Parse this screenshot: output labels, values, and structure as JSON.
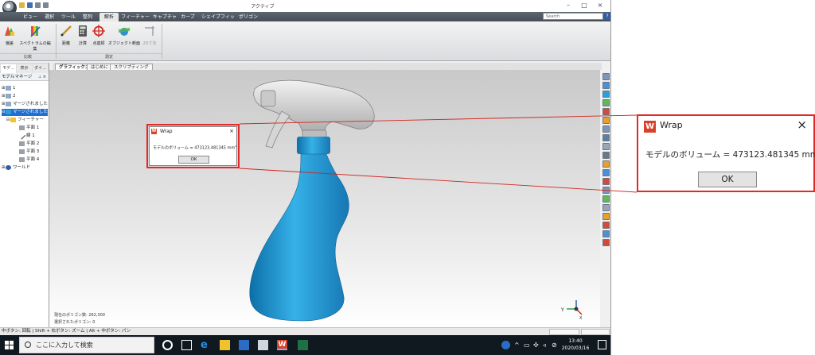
{
  "app": {
    "title": "アクティブ",
    "tabs": [
      {
        "label": "ビュー"
      },
      {
        "label": "選択"
      },
      {
        "label": "ツール"
      },
      {
        "label": "整列"
      },
      {
        "label": "解析"
      },
      {
        "label": "フィーチャー"
      },
      {
        "label": "キャプチャ"
      },
      {
        "label": "カーブ"
      },
      {
        "label": "シェイプフィット"
      },
      {
        "label": "ポリゴン"
      }
    ],
    "active_tab": "解析",
    "search_placeholder": "Search",
    "help_label": "?"
  },
  "ribbon": {
    "groups": [
      {
        "label": "比較",
        "buttons": [
          {
            "label": "偏差",
            "icon": "deviation-icon"
          },
          {
            "label": "スペクトラムの編集",
            "icon": "spectrum-edit-icon"
          }
        ]
      },
      {
        "label": "測定",
        "buttons": [
          {
            "label": "距離",
            "icon": "distance-icon"
          },
          {
            "label": "計算",
            "icon": "calculate-icon"
          },
          {
            "label": "点座標",
            "icon": "point-coordinate-icon"
          },
          {
            "label": "オブジェクト断面",
            "icon": "object-section-icon"
          },
          {
            "label": "2D寸法",
            "icon": "2d-dimension-icon"
          }
        ]
      }
    ]
  },
  "left_panel": {
    "tabs": [
      {
        "label": "モデ..."
      },
      {
        "label": "表示"
      },
      {
        "label": "ダイ..."
      }
    ],
    "header": "モデルマネージ",
    "tree": [
      {
        "label": "1"
      },
      {
        "label": "2"
      },
      {
        "label": "マージされました"
      },
      {
        "label": "マージされました"
      },
      {
        "label": "フィーチャー"
      },
      {
        "label": "平面 1"
      },
      {
        "label": "線 1"
      },
      {
        "label": "平面 2"
      },
      {
        "label": "平面 3"
      },
      {
        "label": "平面 4"
      },
      {
        "label": "ワールド"
      }
    ]
  },
  "viewport": {
    "tabs": [
      {
        "label": "グラフィックス"
      },
      {
        "label": "はじめに"
      },
      {
        "label": "スクリプティング"
      }
    ],
    "info_line1": "現在のポリゴン数: 262,300",
    "info_line2": "選択されたポリゴン: 0",
    "axis_x": "Y",
    "axis_z": "X"
  },
  "dialog": {
    "title": "Wrap",
    "message_prefix": "モデルのボリューム = 473123.481345 mm",
    "message_sup": "3",
    "ok_label": "OK",
    "close_glyph": "×"
  },
  "status_bar": {
    "hint": "中ボタン: 回転 | Shift + 右ボタン: ズーム | Alt + 中ボタン: パン"
  },
  "taskbar": {
    "search_placeholder": "ここに入力して検索",
    "time": "13:40",
    "date": "2020/03/16"
  },
  "colors": {
    "accent_red": "#e02a2a",
    "bottle_blue": "#2a9fd6",
    "tab_bar": "#4f5861",
    "selection": "#1f6fd0"
  }
}
